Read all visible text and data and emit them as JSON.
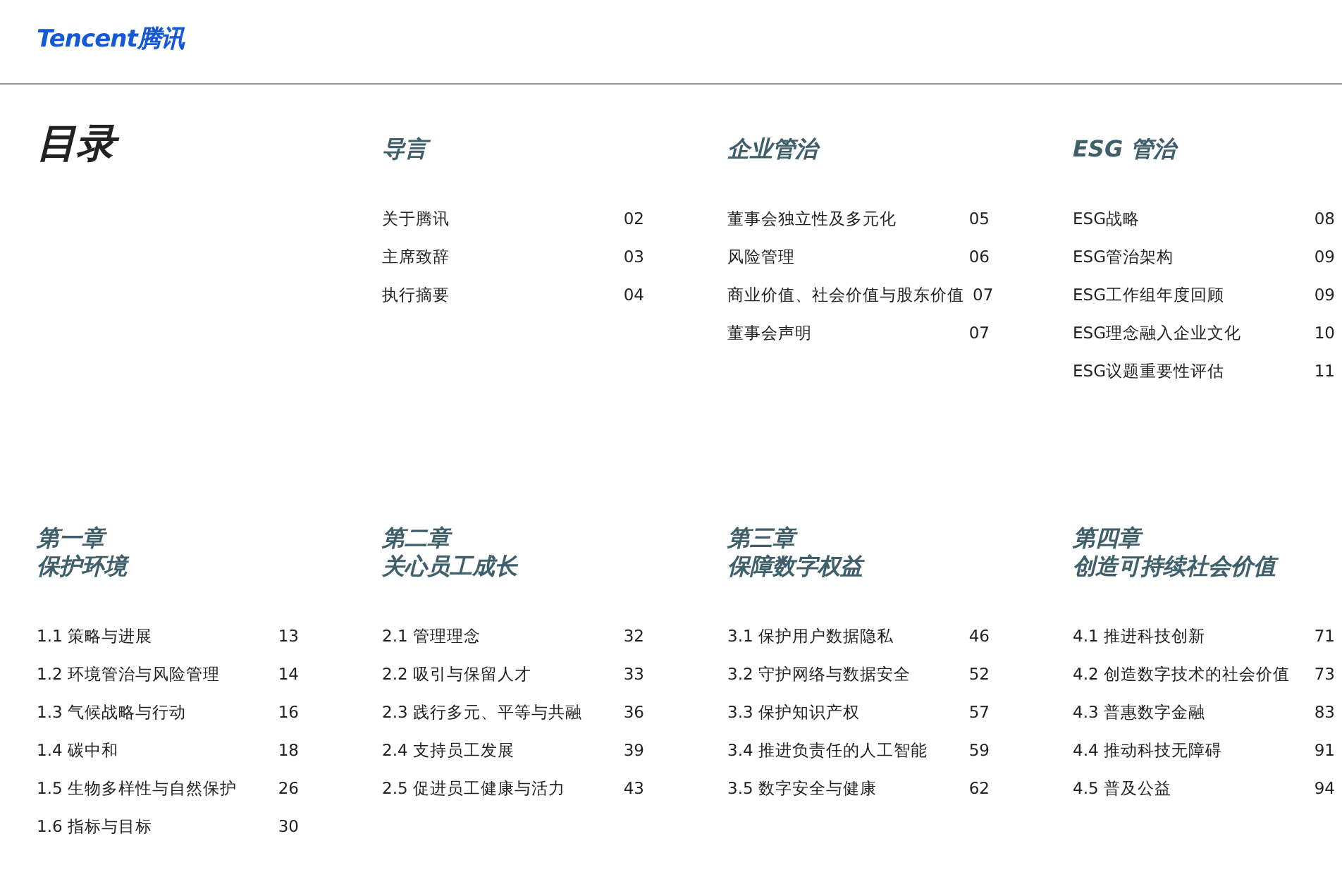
{
  "logo": {
    "latin": "Tencent",
    "chinese": "腾讯"
  },
  "title": "目录",
  "sections": [
    {
      "heading": "导言",
      "entries": [
        {
          "label": "关于腾讯",
          "page": "02"
        },
        {
          "label": "主席致辞",
          "page": "03"
        },
        {
          "label": "执行摘要",
          "page": "04"
        }
      ]
    },
    {
      "heading": "企业管治",
      "entries": [
        {
          "label": "董事会独立性及多元化",
          "page": "05"
        },
        {
          "label": "风险管理",
          "page": "06"
        },
        {
          "label": "商业价值、社会价值与股东价值",
          "page": "07"
        },
        {
          "label": "董事会声明",
          "page": "07"
        }
      ]
    },
    {
      "heading": "ESG 管治",
      "entries": [
        {
          "label": "ESG战略",
          "page": "08"
        },
        {
          "label": "ESG管治架构",
          "page": "09"
        },
        {
          "label": "ESG工作组年度回顾",
          "page": "09"
        },
        {
          "label": "ESG理念融入企业文化",
          "page": "10"
        },
        {
          "label": "ESG议题重要性评估",
          "page": "11"
        }
      ]
    }
  ],
  "chapters": [
    {
      "number": "第一章",
      "title": "保护环境",
      "entries": [
        {
          "label": "1.1 策略与进展",
          "page": "13"
        },
        {
          "label": "1.2 环境管治与风险管理",
          "page": "14"
        },
        {
          "label": "1.3 气候战略与行动",
          "page": "16"
        },
        {
          "label": "1.4 碳中和",
          "page": "18"
        },
        {
          "label": "1.5 生物多样性与自然保护",
          "page": "26"
        },
        {
          "label": "1.6 指标与目标",
          "page": "30"
        }
      ]
    },
    {
      "number": "第二章",
      "title": "关心员工成长",
      "entries": [
        {
          "label": "2.1 管理理念",
          "page": "32"
        },
        {
          "label": "2.2 吸引与保留人才",
          "page": "33"
        },
        {
          "label": "2.3 践行多元、平等与共融",
          "page": "36"
        },
        {
          "label": "2.4 支持员工发展",
          "page": "39"
        },
        {
          "label": "2.5 促进员工健康与活力",
          "page": "43"
        }
      ]
    },
    {
      "number": "第三章",
      "title": "保障数字权益",
      "entries": [
        {
          "label": "3.1 保护用户数据隐私",
          "page": "46"
        },
        {
          "label": "3.2 守护网络与数据安全",
          "page": "52"
        },
        {
          "label": "3.3 保护知识产权",
          "page": "57"
        },
        {
          "label": "3.4 推进负责任的人工智能",
          "page": "59"
        },
        {
          "label": "3.5 数字安全与健康",
          "page": "62"
        }
      ]
    },
    {
      "number": "第四章",
      "title": "创造可持续社会价值",
      "entries": [
        {
          "label": "4.1 推进科技创新",
          "page": "71"
        },
        {
          "label": "4.2 创造数字技术的社会价值",
          "page": "73"
        },
        {
          "label": "4.3 普惠数字金融",
          "page": "83"
        },
        {
          "label": "4.4 推动科技无障碍",
          "page": "91"
        },
        {
          "label": "4.5 普及公益",
          "page": "94"
        }
      ]
    }
  ]
}
